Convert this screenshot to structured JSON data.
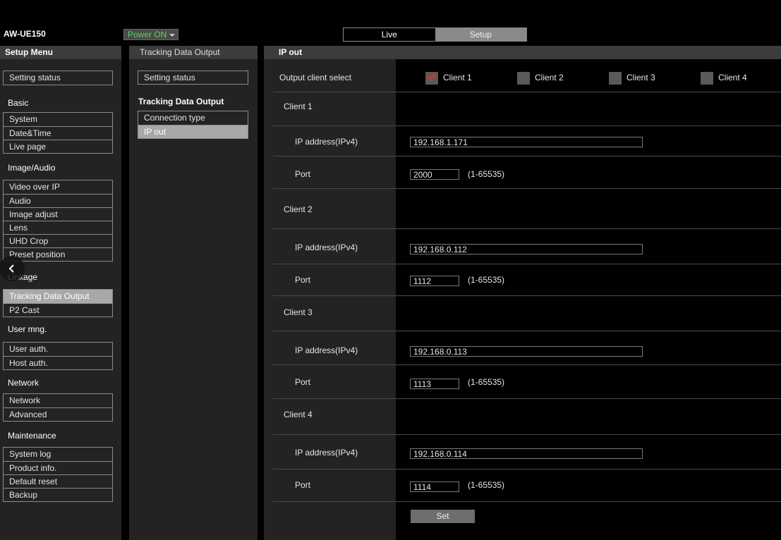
{
  "header": {
    "model": "AW-UE150",
    "power_label": "Power ON",
    "tabs": {
      "live": "Live",
      "setup": "Setup"
    }
  },
  "setup_menu": {
    "title": "Setup Menu",
    "setting_status": "Setting status",
    "sections": {
      "basic": {
        "title": "Basic",
        "items": [
          "System",
          "Date&Time",
          "Live page"
        ]
      },
      "image_audio": {
        "title": "Image/Audio",
        "items": [
          "Video over IP",
          "Audio",
          "Image adjust",
          "Lens",
          "UHD Crop",
          "Preset position"
        ]
      },
      "linkage": {
        "title": "Linkage",
        "items": [
          "Tracking Data Output",
          "P2 Cast"
        ]
      },
      "user_mng": {
        "title": "User mng.",
        "items": [
          "User auth.",
          "Host auth."
        ]
      },
      "network": {
        "title": "Network",
        "items": [
          "Network",
          "Advanced"
        ]
      },
      "maintenance": {
        "title": "Maintenance",
        "items": [
          "System log",
          "Product info.",
          "Default reset",
          "Backup"
        ]
      }
    }
  },
  "sub_menu": {
    "title": "Tracking Data Output",
    "setting_status": "Setting status",
    "group_title": "Tracking Data Output",
    "items": [
      "Connection type",
      "IP out"
    ]
  },
  "main": {
    "title": "IP out",
    "output_client_select_label": "Output client select",
    "clients_select": [
      {
        "label": "Client 1",
        "checked": true
      },
      {
        "label": "Client 2",
        "checked": false
      },
      {
        "label": "Client 3",
        "checked": false
      },
      {
        "label": "Client 4",
        "checked": false
      }
    ],
    "ip_label": "IP address(IPv4)",
    "port_label": "Port",
    "port_range": "(1-65535)",
    "clients": [
      {
        "name": "Client 1",
        "ip": "192.168.1.171",
        "port": "2000"
      },
      {
        "name": "Client 2",
        "ip": "192.168.0.112",
        "port": "1112"
      },
      {
        "name": "Client 3",
        "ip": "192.168.0.113",
        "port": "1113"
      },
      {
        "name": "Client 4",
        "ip": "192.168.0.114",
        "port": "1114"
      }
    ],
    "set_label": "Set"
  },
  "colors": {
    "power_on": "#5cd35c",
    "check_red": "#e23030",
    "active_item": "#a8a8a8"
  }
}
